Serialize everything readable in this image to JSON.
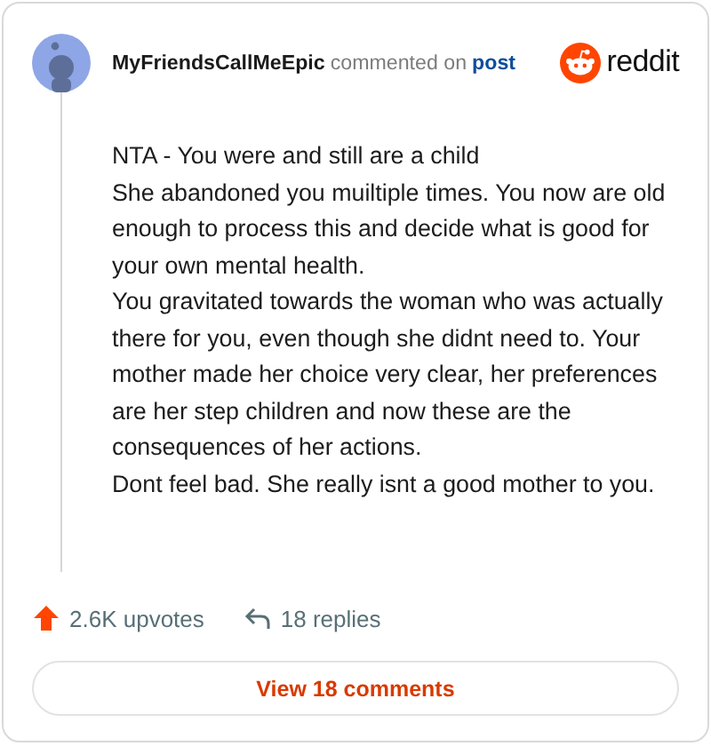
{
  "header": {
    "username": "MyFriendsCallMeEpic",
    "action": "commented on",
    "link": "post",
    "brand": "reddit"
  },
  "comment": {
    "paragraphs": [
      "NTA - You were and still are a child",
      "She abandoned you muiltiple times. You now are old enough to process this and decide what is good for your own mental health.",
      "You gravitated towards the woman who was actually there for you, even though she didnt need to. Your mother made her choice very clear, her preferences are her step children and now these are the consequences of her actions.",
      "Dont feel bad. She really isnt a good mother to you."
    ]
  },
  "footer": {
    "upvotes": "2.6K upvotes",
    "replies": "18 replies",
    "button": "View 18 comments"
  }
}
